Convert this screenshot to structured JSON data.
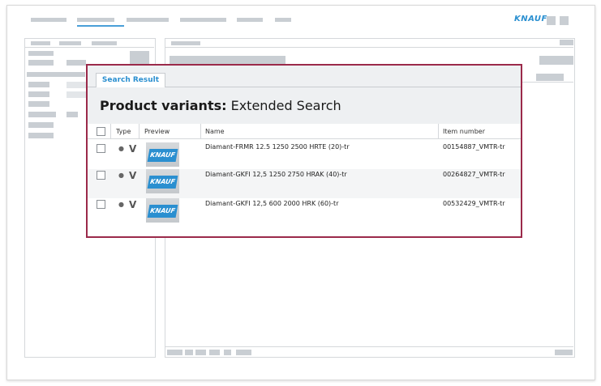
{
  "brand": {
    "logo_text": "KNAUF",
    "accent_color": "#2a8fd0",
    "highlight_border_color": "#9b2a4a"
  },
  "popup": {
    "tab_label": "Search Result",
    "title_bold": "Product variants:",
    "title_rest": " Extended Search",
    "columns": {
      "type": "Type",
      "preview": "Preview",
      "name": "Name",
      "item_number": "Item number"
    },
    "rows": [
      {
        "type": "V",
        "preview_logo": "KNAUF",
        "name": "Diamant-FRMR 12.5 1250 2500 HRTE (20)-tr",
        "item_number": "00154887_VMTR-tr"
      },
      {
        "type": "V",
        "preview_logo": "KNAUF",
        "name": "Diamant-GKFI 12,5 1250 2750 HRAK (40)-tr",
        "item_number": "00264827_VMTR-tr"
      },
      {
        "type": "V",
        "preview_logo": "KNAUF",
        "name": "Diamant-GKFI 12,5 600 2000 HRK (60)-tr",
        "item_number": "00532429_VMTR-tr"
      }
    ]
  }
}
